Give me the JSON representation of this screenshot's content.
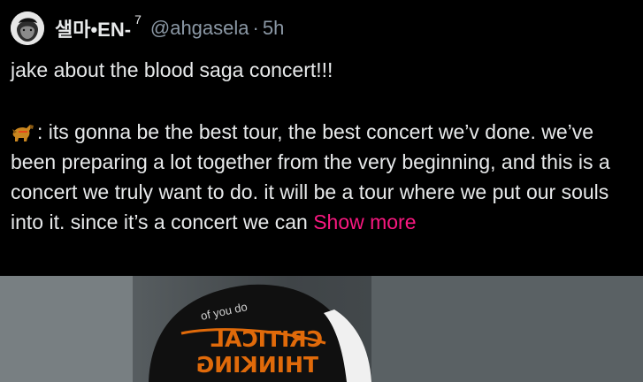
{
  "tweet": {
    "display_name": "샐마•EN-",
    "superscript": "7",
    "handle": "@ahgasela",
    "separator": "·",
    "time": "5h",
    "headline": "jake about the blood saga concert!!!",
    "body_lead": ": its gonna be the best tour, the best concert we’v done. we’ve been preparing a lot together from the very beginning, and this is a concert we truly want to do. it will be a tour where we put our souls into it. since it’s a concert we can",
    "show_more": "Show more"
  },
  "media": {
    "cap_text_top": "of you do",
    "cap_text_line1": "CRITICAL",
    "cap_text_line2": "THINKING"
  },
  "colors": {
    "background": "#000000",
    "text": "#e7e9ea",
    "muted": "#8b98a5",
    "accent": "#f91880"
  },
  "icons": {
    "avatar": "avatar-portrait-icon",
    "emoji": "dog-emoji-icon"
  }
}
